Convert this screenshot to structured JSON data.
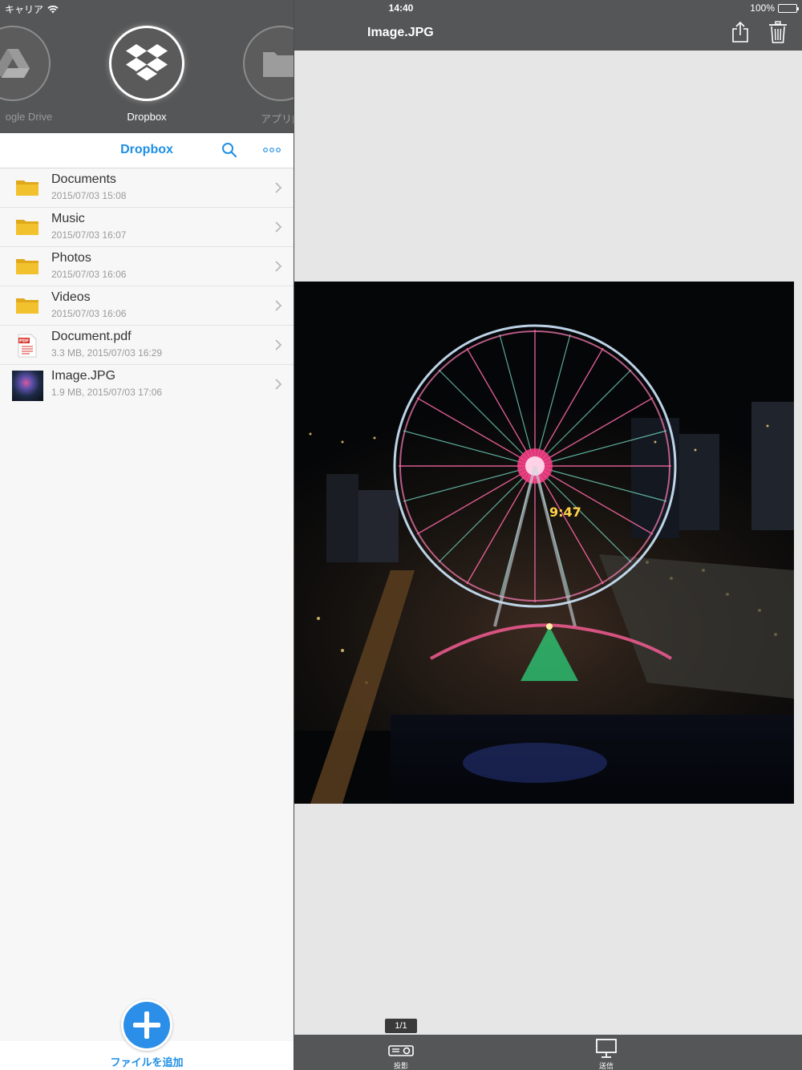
{
  "status_bar": {
    "carrier": "キャリア",
    "time": "14:40",
    "battery": "100%"
  },
  "services": [
    {
      "label": "ogle Drive",
      "icon": "google-drive-icon"
    },
    {
      "label": "Dropbox",
      "icon": "dropbox-icon",
      "active": true
    },
    {
      "label": "アプリ内フォ",
      "icon": "folder-icon"
    }
  ],
  "nav": {
    "title": "Dropbox",
    "search_icon": "search-icon",
    "more_icon": "more-icon"
  },
  "files": [
    {
      "name": "Documents",
      "meta": "2015/07/03 15:08",
      "type": "folder"
    },
    {
      "name": "Music",
      "meta": "2015/07/03 16:07",
      "type": "folder"
    },
    {
      "name": "Photos",
      "meta": "2015/07/03 16:06",
      "type": "folder"
    },
    {
      "name": "Videos",
      "meta": "2015/07/03 16:06",
      "type": "folder"
    },
    {
      "name": "Document.pdf",
      "meta": "3.3 MB, 2015/07/03 16:29",
      "type": "pdf",
      "pdf_badge": "PDF"
    },
    {
      "name": "Image.JPG",
      "meta": "1.9 MB, 2015/07/03 17:06",
      "type": "image"
    }
  ],
  "add_file": {
    "label": "ファイルを追加"
  },
  "viewer": {
    "title": "Image.JPG",
    "page_indicator": "1/1",
    "photo_clock": "9:47"
  },
  "bottom_tabs": [
    {
      "label": "投影",
      "icon": "projector-icon"
    },
    {
      "label": "送信",
      "icon": "monitor-icon"
    }
  ],
  "colors": {
    "accent": "#1f8fe5",
    "header": "#555657",
    "viewer_bg": "#e6e6e6",
    "folder": "#f2c12e"
  }
}
